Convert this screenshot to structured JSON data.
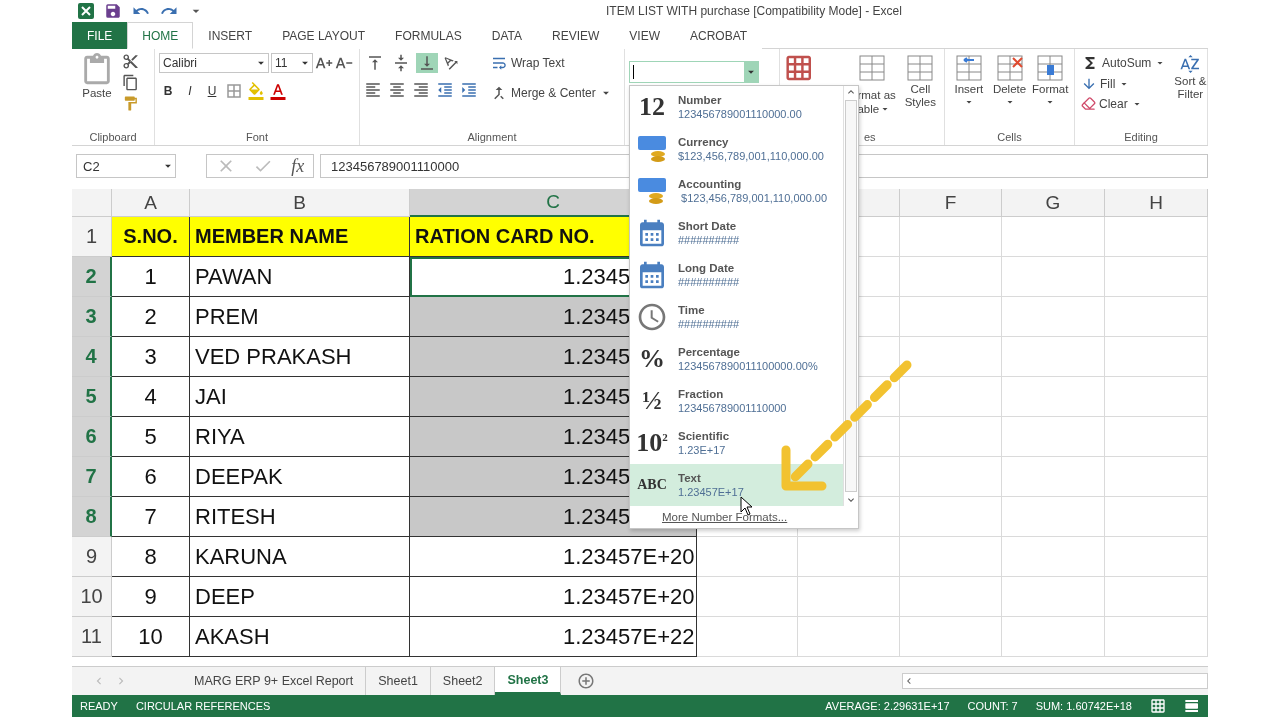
{
  "window": {
    "title": "ITEM LIST WITH purchase  [Compatibility Mode] - Excel"
  },
  "ribbon_tabs": [
    {
      "label": "FILE",
      "kind": "file",
      "selected": false
    },
    {
      "label": "HOME",
      "kind": "tab",
      "selected": true
    },
    {
      "label": "INSERT",
      "kind": "tab",
      "selected": false
    },
    {
      "label": "PAGE LAYOUT",
      "kind": "tab",
      "selected": false
    },
    {
      "label": "FORMULAS",
      "kind": "tab",
      "selected": false
    },
    {
      "label": "DATA",
      "kind": "tab",
      "selected": false
    },
    {
      "label": "REVIEW",
      "kind": "tab",
      "selected": false
    },
    {
      "label": "VIEW",
      "kind": "tab",
      "selected": false
    },
    {
      "label": "ACROBAT",
      "kind": "tab",
      "selected": false
    }
  ],
  "ribbon": {
    "clipboard": {
      "paste": "Paste",
      "label": "Clipboard"
    },
    "font": {
      "name": "Calibri",
      "size": "11",
      "bold": "B",
      "italic": "I",
      "underline": "U",
      "label": "Font"
    },
    "alignment": {
      "vertical": [
        {
          "selected": false
        },
        {
          "selected": false
        },
        {
          "selected": true
        }
      ],
      "wrap_text": "Wrap Text",
      "merge_center": "Merge & Center",
      "label": "Alignment"
    },
    "styles": {
      "format_as_table": [
        "rmat as",
        "able"
      ],
      "cell_styles": [
        "Cell",
        "Styles"
      ],
      "label": "es"
    },
    "cells": {
      "insert": "Insert",
      "delete": "Delete",
      "format": "Format",
      "label": "Cells"
    },
    "editing": {
      "autosum": "AutoSum",
      "fill": "Fill",
      "clear": "Clear",
      "sort_filter": [
        "Sort &",
        "Filter"
      ],
      "label": "Editing"
    }
  },
  "formula_bar": {
    "name_box": "C2",
    "fx": "fx",
    "formula": "123456789001110000"
  },
  "columns": [
    {
      "label": "A",
      "selected": false
    },
    {
      "label": "B",
      "selected": false
    },
    {
      "label": "C",
      "selected": true
    },
    {
      "label": "F",
      "selected": false
    },
    {
      "label": "G",
      "selected": false
    },
    {
      "label": "H",
      "selected": false
    }
  ],
  "rows": [
    {
      "header": "1",
      "kind": "title",
      "selected": false,
      "active": false,
      "cells": [
        "S.NO.",
        "MEMBER NAME",
        "RATION CARD NO."
      ]
    },
    {
      "header": "2",
      "kind": "data",
      "selected": true,
      "active": true,
      "cells": [
        "1",
        "PAWAN",
        "1.2345"
      ]
    },
    {
      "header": "3",
      "kind": "data",
      "selected": true,
      "active": false,
      "cells": [
        "2",
        "PREM",
        "1.2345"
      ]
    },
    {
      "header": "4",
      "kind": "data",
      "selected": true,
      "active": false,
      "cells": [
        "3",
        "VED PRAKASH",
        "1.2345"
      ]
    },
    {
      "header": "5",
      "kind": "data",
      "selected": true,
      "active": false,
      "cells": [
        "4",
        "JAI",
        "1.2345"
      ]
    },
    {
      "header": "6",
      "kind": "data",
      "selected": true,
      "active": false,
      "cells": [
        "5",
        "RIYA",
        "1.2345"
      ]
    },
    {
      "header": "7",
      "kind": "data",
      "selected": true,
      "active": false,
      "cells": [
        "6",
        "DEEPAK",
        "1.2345"
      ]
    },
    {
      "header": "8",
      "kind": "data",
      "selected": true,
      "active": false,
      "cells": [
        "7",
        "RITESH",
        "1.2345"
      ]
    },
    {
      "header": "9",
      "kind": "data",
      "selected": false,
      "active": false,
      "cells": [
        "8",
        "KARUNA",
        "1.23457E+20"
      ]
    },
    {
      "header": "10",
      "kind": "data",
      "selected": false,
      "active": false,
      "cells": [
        "9",
        "DEEP",
        "1.23457E+20"
      ]
    },
    {
      "header": "11",
      "kind": "data",
      "selected": false,
      "active": false,
      "cells": [
        "10",
        "AKASH",
        "1.23457E+22"
      ]
    }
  ],
  "number_format_menu": {
    "items": [
      {
        "kind": "number",
        "glyph": "12",
        "label": "Number",
        "sample": "123456789001110000.00",
        "selected": false
      },
      {
        "kind": "currency",
        "label": "Currency",
        "sample": "$123,456,789,001,110,000.00",
        "selected": false
      },
      {
        "kind": "accounting",
        "label": "Accounting",
        "sample": " $123,456,789,001,110,000.00",
        "selected": false
      },
      {
        "kind": "date",
        "label": "Short Date",
        "sample": "##########",
        "selected": false
      },
      {
        "kind": "date",
        "label": "Long Date",
        "sample": "##########",
        "selected": false
      },
      {
        "kind": "time",
        "label": "Time",
        "sample": "##########",
        "selected": false
      },
      {
        "kind": "glyph",
        "glyph": "%",
        "label": "Percentage",
        "sample": "1234567890011100000.00%",
        "selected": false
      },
      {
        "kind": "glyph",
        "glyph": "½",
        "label": "Fraction",
        "sample": "123456789001110000",
        "selected": false
      },
      {
        "kind": "glyph",
        "glyph": "10$^{2}$",
        "label": "Scientific",
        "sample": "1.23E+17",
        "selected": false
      },
      {
        "kind": "glyph",
        "glyph": "ABC",
        "label": "Text",
        "sample": "1.23457E+17",
        "selected": true
      }
    ],
    "more": "More Number Formats..."
  },
  "sheet_tabs": [
    {
      "label": "MARG ERP 9+ Excel Report",
      "selected": false
    },
    {
      "label": "Sheet1",
      "selected": false
    },
    {
      "label": "Sheet2",
      "selected": false
    },
    {
      "label": "Sheet3",
      "selected": true
    }
  ],
  "status_bar": {
    "left": [
      "READY",
      "CIRCULAR REFERENCES"
    ],
    "right": [
      "AVERAGE: 2.29631E+17",
      "COUNT: 7",
      "SUM: 1.60742E+18"
    ]
  }
}
